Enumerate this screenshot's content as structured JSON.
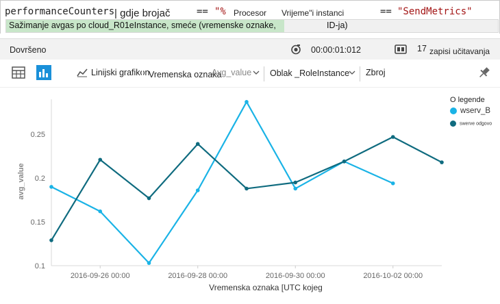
{
  "query": {
    "line1": {
      "t1": "performanceCounters",
      "t2": "| gdje brojač",
      "t3": "==",
      "t4": "\"%",
      "t5": "Procesor",
      "t6": "Vrijeme\"i instanci",
      "t7": "==",
      "t8": "\"SendMetrics\""
    },
    "line2": {
      "text": "Sažimanje avgas po cloud_R01eInstance, smeće (vremenske oznake,",
      "tail": "ID-ja)"
    }
  },
  "status": {
    "state": "Dovršeno",
    "elapsed": "00:00:01:012",
    "count": "17",
    "records_label": "zapisi učitavanja"
  },
  "toolbar": {
    "line_chart": "Linijski grafikon",
    "x_field": "Vremenska oznaka",
    "y_field": "Avg_value",
    "split_field": "Oblak _RoleInstance",
    "aggregate": "Zbroj"
  },
  "colors": {
    "series_light": "#1ab3e6",
    "series_dark": "#0f6b7f"
  },
  "chart_data": {
    "type": "line",
    "ylabel": "avg_value",
    "xlabel": "Vremenska oznaka [UTC kojeg",
    "ylim": [
      0.1,
      0.29
    ],
    "yticks": [
      "0.1",
      "0.15",
      "0.2",
      "0.25"
    ],
    "xticks": [
      "2016-09-26 00:00",
      "2016-09-28 00:00",
      "2016-09-30 00:00",
      "2016-10-02 00:00"
    ],
    "legend_title": "O legende",
    "legend_position": "top-right",
    "grid": false,
    "series": [
      {
        "name": "wserv_B",
        "color": "#1ab3e6",
        "x": [
          "2016-09-25 00:00",
          "2016-09-26 00:00",
          "2016-09-27 00:00",
          "2016-09-28 00:00",
          "2016-09-29 00:00",
          "2016-09-30 00:00",
          "2016-10-01 00:00",
          "2016-10-02 00:00"
        ],
        "values": [
          0.19,
          0.162,
          0.103,
          0.186,
          0.287,
          0.188,
          0.219,
          0.194
        ]
      },
      {
        "name": "swerve odgovo",
        "color": "#0f6b7f",
        "x": [
          "2016-09-25 00:00",
          "2016-09-26 00:00",
          "2016-09-27 00:00",
          "2016-09-28 00:00",
          "2016-09-29 00:00",
          "2016-09-30 00:00",
          "2016-10-01 00:00",
          "2016-10-02 00:00",
          "2016-10-03 00:00"
        ],
        "values": [
          0.129,
          0.221,
          0.177,
          0.239,
          0.188,
          0.195,
          0.219,
          0.247,
          0.218
        ]
      }
    ]
  }
}
